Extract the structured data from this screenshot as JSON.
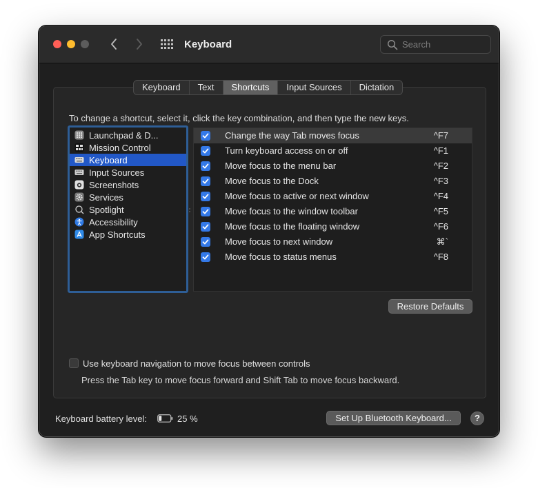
{
  "window": {
    "title": "Keyboard",
    "search_placeholder": "Search"
  },
  "tabs": [
    {
      "label": "Keyboard",
      "active": false
    },
    {
      "label": "Text",
      "active": false
    },
    {
      "label": "Shortcuts",
      "active": true
    },
    {
      "label": "Input Sources",
      "active": false
    },
    {
      "label": "Dictation",
      "active": false
    }
  ],
  "instruction": "To change a shortcut, select it, click the key combination, and then type the new keys.",
  "sidebar": {
    "items": [
      {
        "label": "Launchpad & D...",
        "icon": "launchpad-icon",
        "selected": false
      },
      {
        "label": "Mission Control",
        "icon": "mission-control-icon",
        "selected": false
      },
      {
        "label": "Keyboard",
        "icon": "keyboard-icon",
        "selected": true
      },
      {
        "label": "Input Sources",
        "icon": "input-sources-icon",
        "selected": false
      },
      {
        "label": "Screenshots",
        "icon": "screenshot-icon",
        "selected": false
      },
      {
        "label": "Services",
        "icon": "gear-icon",
        "selected": false
      },
      {
        "label": "Spotlight",
        "icon": "spotlight-icon",
        "selected": false
      },
      {
        "label": "Accessibility",
        "icon": "accessibility-icon",
        "selected": false
      },
      {
        "label": "App Shortcuts",
        "icon": "app-store-icon",
        "selected": false
      }
    ]
  },
  "shortcuts": [
    {
      "label": "Change the way Tab moves focus",
      "key": "^F7",
      "checked": true,
      "highlighted": true
    },
    {
      "label": "Turn keyboard access on or off",
      "key": "^F1",
      "checked": true,
      "highlighted": false
    },
    {
      "label": "Move focus to the menu bar",
      "key": "^F2",
      "checked": true,
      "highlighted": false
    },
    {
      "label": "Move focus to the Dock",
      "key": "^F3",
      "checked": true,
      "highlighted": false
    },
    {
      "label": "Move focus to active or next window",
      "key": "^F4",
      "checked": true,
      "highlighted": false
    },
    {
      "label": "Move focus to the window toolbar",
      "key": "^F5",
      "checked": true,
      "highlighted": false
    },
    {
      "label": "Move focus to the floating window",
      "key": "^F6",
      "checked": true,
      "highlighted": false
    },
    {
      "label": "Move focus to next window",
      "key": "⌘`",
      "checked": true,
      "highlighted": false
    },
    {
      "label": "Move focus to status menus",
      "key": "^F8",
      "checked": true,
      "highlighted": false
    }
  ],
  "restore_defaults_label": "Restore Defaults",
  "keyboard_navigation": {
    "checked": false,
    "label": "Use keyboard navigation to move focus between controls",
    "description": "Press the Tab key to move focus forward and Shift Tab to move focus backward."
  },
  "footer": {
    "battery_label": "Keyboard battery level:",
    "battery_value": "25 %",
    "battery_level": 0.25,
    "bluetooth_button_label": "Set Up Bluetooth Keyboard...",
    "help_label": "?"
  },
  "colors": {
    "accent": "#2258c7",
    "checkbox": "#3479e8",
    "traffic_red": "#ff5f57",
    "traffic_yellow": "#febc2e",
    "traffic_inactive": "#5c5c5c"
  }
}
